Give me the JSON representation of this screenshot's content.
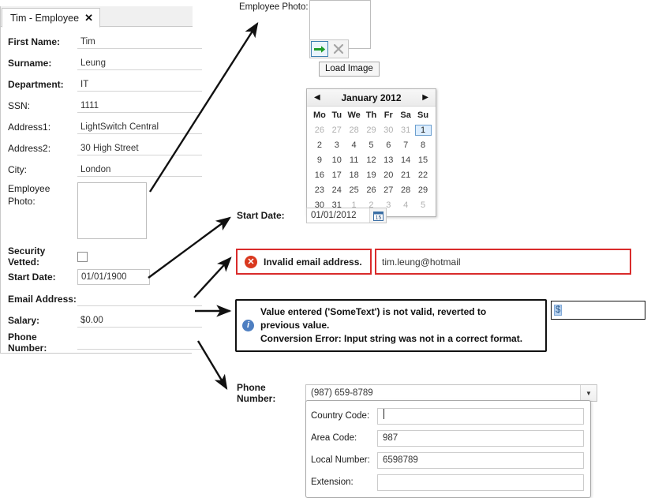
{
  "window": {
    "tab_title": "Tim - Employee",
    "close_glyph": "✕"
  },
  "form": {
    "fields": [
      {
        "label": "First Name:",
        "value": "Tim"
      },
      {
        "label": "Surname:",
        "value": "Leung"
      },
      {
        "label": "Department:",
        "value": "IT"
      },
      {
        "label": "SSN:",
        "value": "1111"
      },
      {
        "label": "Address1:",
        "value": "LightSwitch Central"
      },
      {
        "label": "Address2:",
        "value": "30 High Street"
      },
      {
        "label": "City:",
        "value": "London"
      },
      {
        "label": "Employee Photo:",
        "value": ""
      },
      {
        "label": "Security Vetted:",
        "value": ""
      },
      {
        "label": "Start Date:",
        "value": "01/01/1900"
      },
      {
        "label": "Email Address:",
        "value": ""
      },
      {
        "label": "Salary:",
        "value": "$0.00"
      },
      {
        "label": "Phone Number:",
        "value": ""
      }
    ]
  },
  "photo_callout": {
    "label": "Employee Photo:",
    "load_button_icon": "load-image-arrow-icon",
    "clear_button_icon": "clear-image-x-icon",
    "tooltip": "Load Image"
  },
  "calendar": {
    "prev_glyph": "◀",
    "next_glyph": "▶",
    "title": "January 2012",
    "day_headers": [
      "Mo",
      "Tu",
      "We",
      "Th",
      "Fr",
      "Sa",
      "Su"
    ],
    "weeks": [
      [
        {
          "d": "26",
          "dim": true
        },
        {
          "d": "27",
          "dim": true
        },
        {
          "d": "28",
          "dim": true
        },
        {
          "d": "29",
          "dim": true
        },
        {
          "d": "30",
          "dim": true
        },
        {
          "d": "31",
          "dim": true
        },
        {
          "d": "1",
          "sel": true
        }
      ],
      [
        {
          "d": "2"
        },
        {
          "d": "3"
        },
        {
          "d": "4"
        },
        {
          "d": "5"
        },
        {
          "d": "6"
        },
        {
          "d": "7"
        },
        {
          "d": "8"
        }
      ],
      [
        {
          "d": "9"
        },
        {
          "d": "10"
        },
        {
          "d": "11"
        },
        {
          "d": "12"
        },
        {
          "d": "13"
        },
        {
          "d": "14"
        },
        {
          "d": "15"
        }
      ],
      [
        {
          "d": "16"
        },
        {
          "d": "17"
        },
        {
          "d": "18"
        },
        {
          "d": "19"
        },
        {
          "d": "20"
        },
        {
          "d": "21"
        },
        {
          "d": "22"
        }
      ],
      [
        {
          "d": "23"
        },
        {
          "d": "24"
        },
        {
          "d": "25"
        },
        {
          "d": "26"
        },
        {
          "d": "27"
        },
        {
          "d": "28"
        },
        {
          "d": "29"
        }
      ],
      [
        {
          "d": "30"
        },
        {
          "d": "31"
        },
        {
          "d": "1",
          "dim": true
        },
        {
          "d": "2",
          "dim": true
        },
        {
          "d": "3",
          "dim": true
        },
        {
          "d": "4",
          "dim": true
        },
        {
          "d": "5",
          "dim": true
        }
      ]
    ]
  },
  "start_date_callout": {
    "label": "Start Date:",
    "value": "01/01/2012",
    "picker_icon": "calendar-icon",
    "picker_day": "15"
  },
  "email_validation": {
    "error_icon": "error-x-circle-icon",
    "error_text": "Invalid email address.",
    "value": "tim.leung@hotmail",
    "border_color": "#d92b2b"
  },
  "conversion_info": {
    "info_icon": "info-circle-icon",
    "line1": "Value entered ('SomeText') is not valid, reverted to",
    "line2": "previous value.",
    "line3": "Conversion Error: Input string was not in a correct format.",
    "salary_selected_text": "$"
  },
  "phone_callout": {
    "label": "Phone Number:",
    "value": "(987) 659-8789",
    "dropdown_glyph": "▼",
    "popup_fields": [
      {
        "label": "Country Code:",
        "value": ""
      },
      {
        "label": "Area Code:",
        "value": "987"
      },
      {
        "label": "Local Number:",
        "value": "6598789"
      },
      {
        "label": "Extension:",
        "value": ""
      }
    ]
  }
}
